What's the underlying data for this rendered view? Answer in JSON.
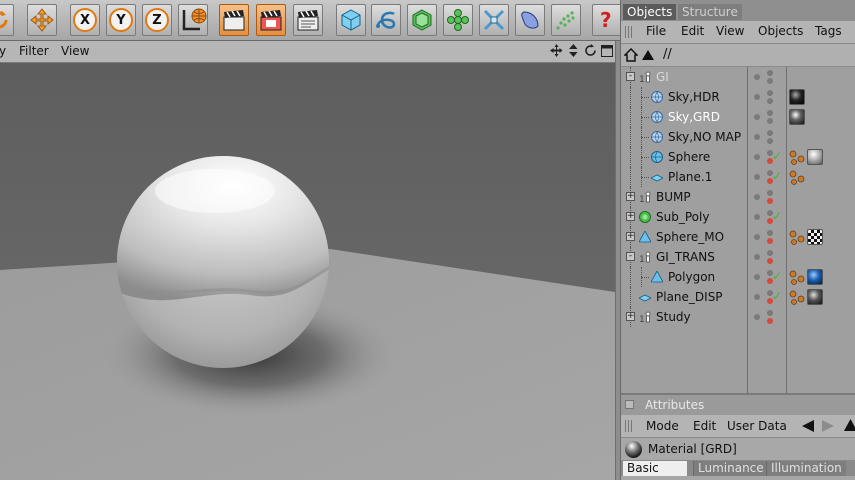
{
  "viewport_menu": {
    "partial": "y",
    "filter": "Filter",
    "view": "View"
  },
  "object_manager": {
    "tabs": [
      "Objects",
      "Structure"
    ],
    "menu": [
      "File",
      "Edit",
      "View",
      "Objects",
      "Tags"
    ],
    "path": "//",
    "rows": [
      {
        "name": "GI",
        "indent": 0,
        "expand": "-",
        "type": "null",
        "style": "dim",
        "tags": [],
        "check": false
      },
      {
        "name": "Sky,HDR",
        "indent": 1,
        "type": "sky",
        "tags": [
          "material-black"
        ],
        "check": false
      },
      {
        "name": "Sky,GRD",
        "indent": 1,
        "type": "sky",
        "style": "hl",
        "tags": [
          "material-dark-selected"
        ],
        "check": false
      },
      {
        "name": "Sky,NO MAP",
        "indent": 1,
        "type": "sky",
        "tags": [],
        "check": false
      },
      {
        "name": "Sphere",
        "indent": 1,
        "type": "sphere",
        "tags": [
          "texture",
          "material-grey"
        ],
        "check": true
      },
      {
        "name": "Plane.1",
        "indent": 1,
        "type": "plane",
        "tags": [
          "texture"
        ],
        "check": true
      },
      {
        "name": "BUMP",
        "indent": 0,
        "expand": "+",
        "type": "null",
        "tags": [],
        "check": false
      },
      {
        "name": "Sub_Poly",
        "indent": 0,
        "expand": "+",
        "type": "hypernurbs",
        "tags": [],
        "check": true
      },
      {
        "name": "Sphere_MO",
        "indent": 0,
        "expand": "+",
        "type": "cone",
        "tags": [
          "texture",
          "material-checker"
        ],
        "check": false
      },
      {
        "name": "GI_TRANS",
        "indent": 0,
        "expand": "-",
        "type": "null",
        "tags": [],
        "check": false
      },
      {
        "name": "Polygon",
        "indent": 1,
        "type": "polygon",
        "tags": [
          "texture",
          "material-blue"
        ],
        "check": true
      },
      {
        "name": "Plane_DISP",
        "indent": 0,
        "type": "plane",
        "tags": [
          "texture",
          "material-dark"
        ],
        "check": true
      },
      {
        "name": "Study",
        "indent": 0,
        "expand": "+",
        "type": "null",
        "tags": [],
        "check": false
      }
    ]
  },
  "attributes": {
    "title": "Attributes",
    "menu": [
      "Mode",
      "Edit",
      "User Data"
    ],
    "material_label": "Material [GRD]",
    "tabs": [
      "Basic",
      "Luminance",
      "Illumination"
    ]
  },
  "colors": {
    "accent": "#e07a10",
    "enabled_red": "#d44a3a",
    "check_green": "#4fae3a",
    "selection": "#5b5b5b"
  }
}
